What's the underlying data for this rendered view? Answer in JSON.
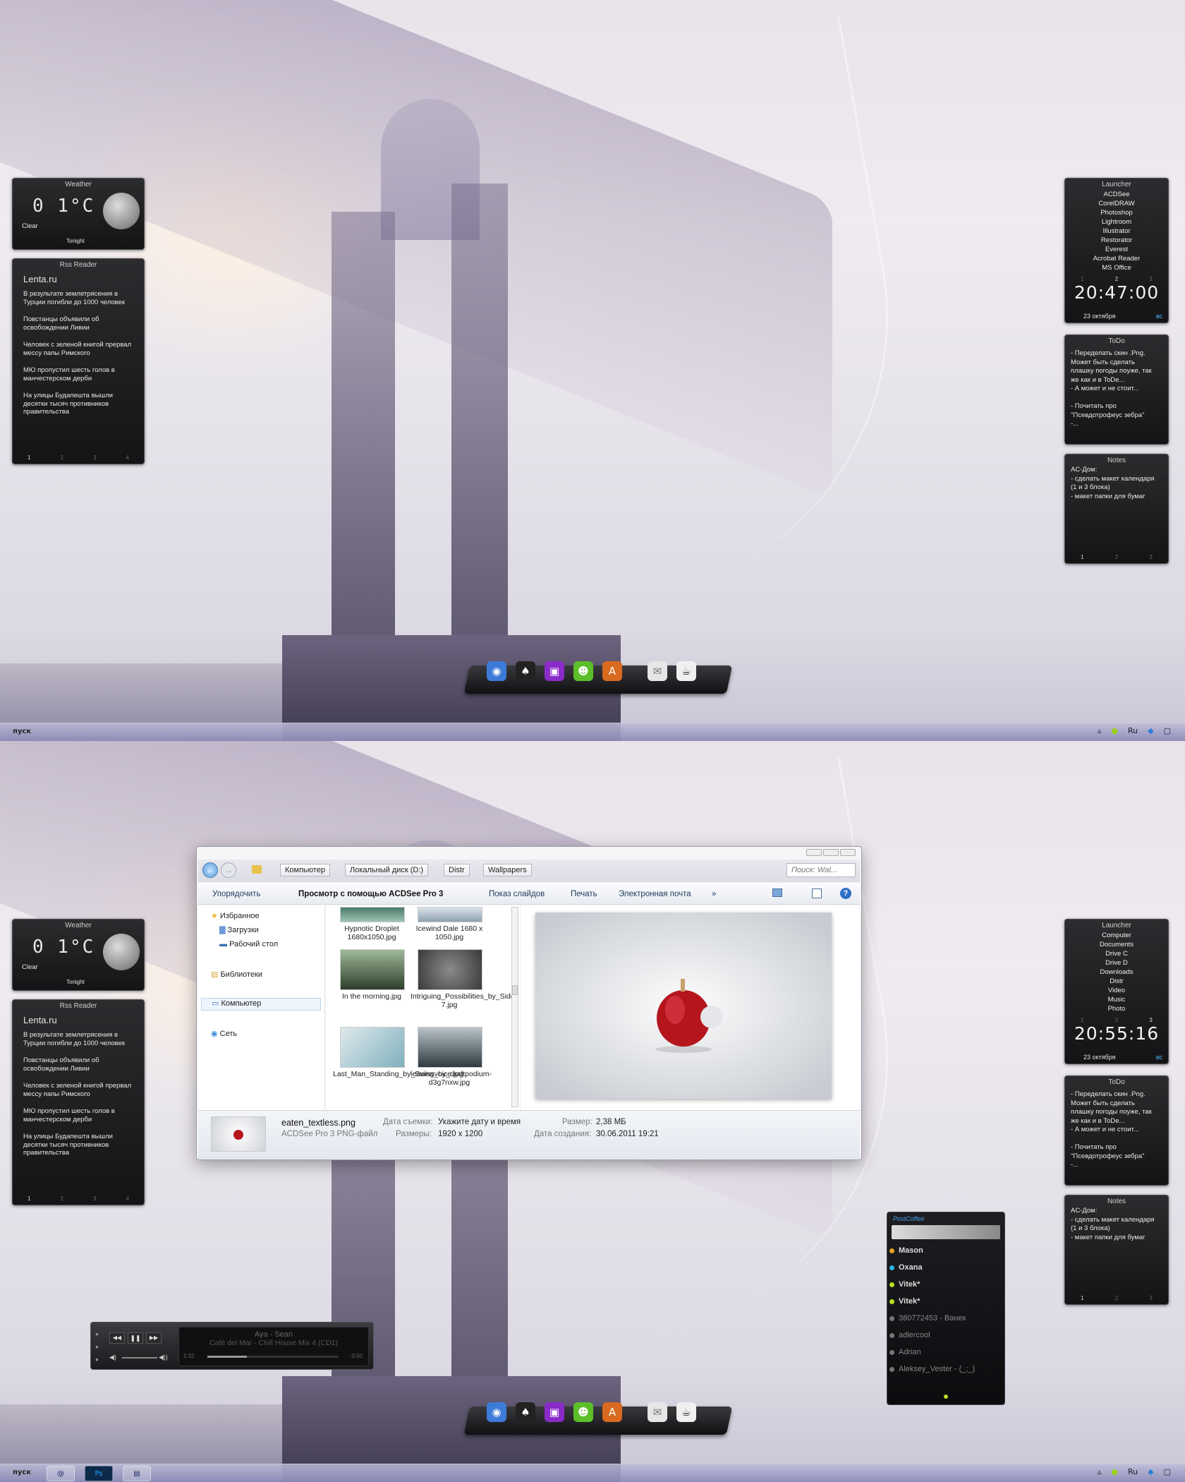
{
  "screen1": {
    "weather": {
      "title": "Weather",
      "temp": "0 1°C",
      "condition": "Clear",
      "tonight": "Tonight"
    },
    "rss": {
      "title": "Rss Reader",
      "source": "Lenta.ru",
      "items": [
        "В результате землетрясения в Турции погибли до 1000 человек",
        "Повстанцы объявили об освобождении Ливии",
        "Человек с зеленой книгой прервал мессу папы Римского",
        "МЮ пропустил шесть голов в манчестерском дерби",
        "На улицы Будапешта вышли десятки тысяч противников правительства"
      ],
      "pages": [
        "1",
        "2",
        "3",
        "4"
      ]
    },
    "launcher": {
      "title": "Launcher",
      "items": [
        "ACDSee",
        "CorelDRAW",
        "Photoshop",
        "Lightroom",
        "Illustrator",
        "Restorator",
        "Everest",
        "Acrobat Reader",
        "MS Office"
      ],
      "pages": [
        "1",
        "2",
        "3"
      ],
      "time": "20:47:00",
      "date": "23 октября",
      "day": "вс"
    },
    "todo": {
      "title": "ToDo",
      "text": "- Переделать скин .Png.\nМожет быть сделать\nплашку погоды поуже, так\nже как и в ToDe...\n- А может и не стоит...\n\n- Почитать про\n\"Псевдотрофеус зебра\"\n-..."
    },
    "notes": {
      "title": "Notes",
      "text": "AC-Дом:\n- сделать макет календаря\n(1 и 3 блока)\n- макет папки для бумаг",
      "pages": [
        "1",
        "2",
        "3"
      ]
    },
    "taskbar": {
      "start": "пуск",
      "lang": "Ru"
    }
  },
  "screen2": {
    "launcher": {
      "title": "Launcher",
      "items": [
        "Computer",
        "Documents",
        "Drive C",
        "Drive D",
        "Downloads",
        "Distr",
        "Video",
        "Music",
        "Photo"
      ],
      "pages": [
        "1",
        "2",
        "3"
      ],
      "time": "20:55:16",
      "date": "23 октября",
      "day": "вс"
    },
    "explorer": {
      "breadcrumbs": [
        "Компьютер",
        "Локальный диск (D:)",
        "Distr",
        "Wallpapers"
      ],
      "search_placeholder": "Поиск: Wal...",
      "toolbar": [
        "Упорядочить",
        "Просмотр с помощью ACDSee Pro 3",
        "Показ слайдов",
        "Печать",
        "Электронная почта",
        "»"
      ],
      "nav": [
        "Избранное",
        "Загрузки",
        "Рабочий стол",
        "Библиотеки",
        "Компьютер",
        "Сеть"
      ],
      "files": [
        "Hypnotic Droplet 1680x1050.jpg",
        "Icewind Dale 1680 x 1050.jpg",
        "In the morning.jpg",
        "Intriguing_Possibilities_by_Side-7.jpg",
        "Last_Man_Standing_by_Swissvoice.jpg",
        "leaving_by_draftpodium-d3g7nxw.jpg"
      ],
      "details": {
        "filename": "eaten_textless.png",
        "filetype": "ACDSee Pro 3 PNG-файл",
        "date_taken_label": "Дата съемки:",
        "date_taken_value": "Укажите дату и время",
        "dims_label": "Размеры:",
        "dims_value": "1920 x 1200",
        "size_label": "Размер:",
        "size_value": "2,38 МБ",
        "created_label": "Дата создания:",
        "created_value": "30.06.2011 19:21"
      }
    },
    "player": {
      "artist": "Aya - Sean",
      "track": "Café del Mar - Chill House Mix 4 (CD1)",
      "elapsed": "1:32",
      "remaining": "-3:50",
      "progress": 0.3
    },
    "messenger": {
      "title": "PostCoffee",
      "contacts": [
        {
          "name": "Mason",
          "status": "#e8a020"
        },
        {
          "name": "Oxana",
          "status": "#2fb0e0"
        },
        {
          "name": "Vitek*",
          "status": "#b8e020"
        },
        {
          "name": "Vitek*",
          "status": "#b8e020"
        },
        {
          "name": "380772453 - Ванек",
          "status": "#777777"
        },
        {
          "name": "adlercool",
          "status": "#777777"
        },
        {
          "name": "Adrian",
          "status": "#777777"
        },
        {
          "name": "Aleksey_Vester - (_;_)",
          "status": "#777777"
        }
      ]
    },
    "taskbar": {
      "start": "пуск",
      "lang": "Ru"
    }
  }
}
